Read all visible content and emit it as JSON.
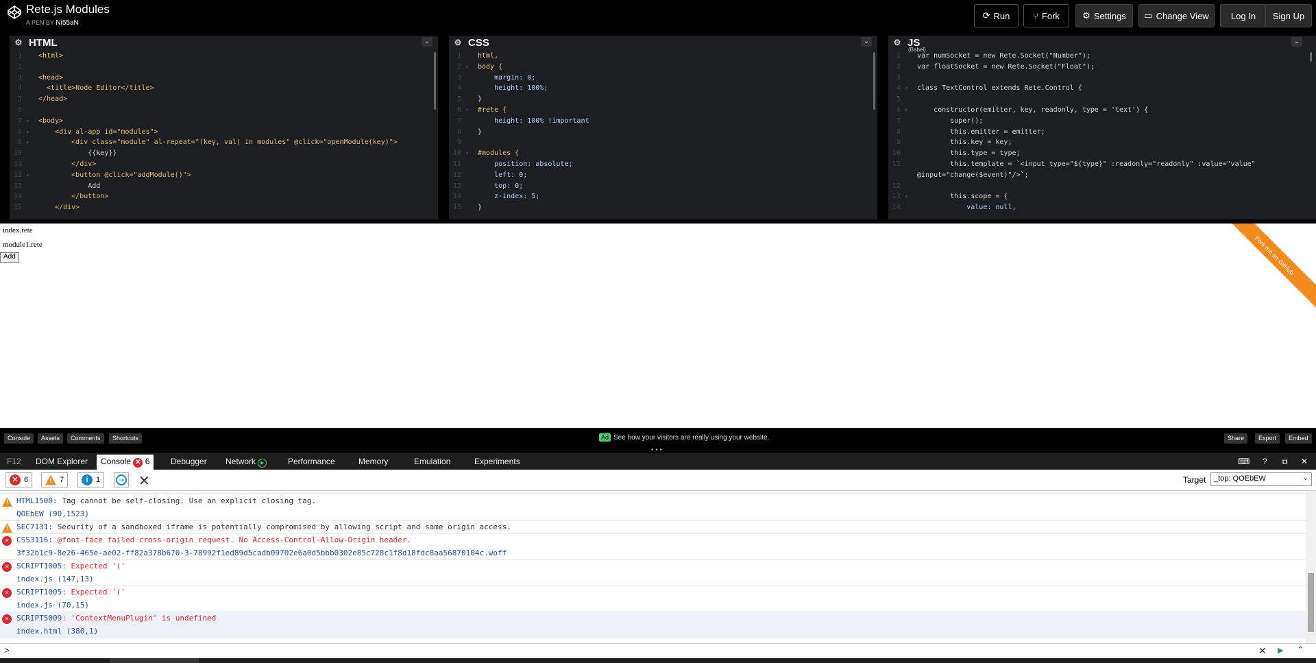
{
  "header": {
    "title": "Rete.js Modules",
    "byline_prefix": "A PEN BY",
    "author": "Ni55aN",
    "buttons": {
      "run": "Run",
      "fork": "Fork",
      "settings": "Settings",
      "change_view": "Change View",
      "log_in": "Log In",
      "sign_up": "Sign Up"
    }
  },
  "editors": {
    "html": {
      "label": "HTML",
      "lines": [
        {
          "n": "1",
          "a": "",
          "t": "<html>"
        },
        {
          "n": "2",
          "a": "",
          "t": ""
        },
        {
          "n": "3",
          "a": "",
          "t": "<head>"
        },
        {
          "n": "4",
          "a": "",
          "t": "  <title>Node Editor</title>"
        },
        {
          "n": "5",
          "a": "",
          "t": "</head>"
        },
        {
          "n": "6",
          "a": "",
          "t": ""
        },
        {
          "n": "7",
          "a": "▾",
          "t": "<body>"
        },
        {
          "n": "8",
          "a": "▾",
          "t": "    <div al-app id=\"modules\">"
        },
        {
          "n": "9",
          "a": "▾",
          "t": "        <div class=\"module\" al-repeat=\"(key, val) in modules\" @click=\"openModule(key)\">"
        },
        {
          "n": "10",
          "a": "",
          "t": "            {{key}}"
        },
        {
          "n": "11",
          "a": "",
          "t": "        </div>"
        },
        {
          "n": "12",
          "a": "▾",
          "t": "        <button @click=\"addModule()\">"
        },
        {
          "n": "13",
          "a": "",
          "t": "            Add"
        },
        {
          "n": "14",
          "a": "",
          "t": "        </button>"
        },
        {
          "n": "15",
          "a": "",
          "t": "    </div>"
        }
      ]
    },
    "css": {
      "label": "CSS",
      "lines": [
        {
          "n": "1",
          "a": "",
          "t": "html,"
        },
        {
          "n": "2",
          "a": "▾",
          "t": "body {"
        },
        {
          "n": "3",
          "a": "",
          "t": "    margin: 0;"
        },
        {
          "n": "4",
          "a": "",
          "t": "    height: 100%;"
        },
        {
          "n": "5",
          "a": "",
          "t": "}"
        },
        {
          "n": "6",
          "a": "▾",
          "t": "#rete {"
        },
        {
          "n": "7",
          "a": "",
          "t": "    height: 100% !important"
        },
        {
          "n": "8",
          "a": "",
          "t": "}"
        },
        {
          "n": "9",
          "a": "",
          "t": ""
        },
        {
          "n": "10",
          "a": "▾",
          "t": "#modules {"
        },
        {
          "n": "11",
          "a": "",
          "t": "    position: absolute;"
        },
        {
          "n": "12",
          "a": "",
          "t": "    left: 0;"
        },
        {
          "n": "13",
          "a": "",
          "t": "    top: 0;"
        },
        {
          "n": "14",
          "a": "",
          "t": "    z-index: 5;"
        },
        {
          "n": "15",
          "a": "",
          "t": "}"
        }
      ]
    },
    "js": {
      "label": "JS",
      "tag": "(Babel)",
      "lines": [
        {
          "n": "1",
          "a": "",
          "t": "var numSocket = new Rete.Socket(\"Number\");"
        },
        {
          "n": "2",
          "a": "",
          "t": "var floatSocket = new Rete.Socket(\"Float\");"
        },
        {
          "n": "3",
          "a": "",
          "t": ""
        },
        {
          "n": "4",
          "a": "▾",
          "t": "class TextControl extends Rete.Control {"
        },
        {
          "n": "5",
          "a": "",
          "t": ""
        },
        {
          "n": "6",
          "a": "▾",
          "t": "    constructor(emitter, key, readonly, type = 'text') {"
        },
        {
          "n": "7",
          "a": "",
          "t": "        super();"
        },
        {
          "n": "8",
          "a": "",
          "t": "        this.emitter = emitter;"
        },
        {
          "n": "9",
          "a": "",
          "t": "        this.key = key;"
        },
        {
          "n": "10",
          "a": "",
          "t": "        this.type = type;"
        },
        {
          "n": "11",
          "a": "",
          "t": "        this.template = `<input type=\"${type}\" :readonly=\"readonly\" :value=\"value\""
        },
        {
          "n": "",
          "a": "",
          "t": "@input=\"change($event)\"/>`;"
        },
        {
          "n": "12",
          "a": "",
          "t": ""
        },
        {
          "n": "13",
          "a": "▾",
          "t": "        this.scope = {"
        },
        {
          "n": "14",
          "a": "",
          "t": "            value: null,"
        }
      ]
    }
  },
  "preview": {
    "items": [
      "index.rete",
      "module1.rete"
    ],
    "add_button": "Add",
    "ribbon": "Fork me on GitHub"
  },
  "footer": {
    "console": "Console",
    "assets": "Assets",
    "comments": "Comments",
    "shortcuts": "Shortcuts",
    "ad_badge": "Ad",
    "ad_text": "See how your visitors are really using your website.",
    "share": "Share",
    "export": "Export",
    "embed": "Embed"
  },
  "devtools": {
    "tabs": {
      "f12": "F12",
      "dom": "DOM Explorer",
      "console": "Console",
      "console_count": "6",
      "debugger": "Debugger",
      "network": "Network",
      "performance": "Performance",
      "memory": "Memory",
      "emulation": "Emulation",
      "experiments": "Experiments"
    },
    "counts": {
      "errors": "6",
      "warnings": "7",
      "info": "1"
    },
    "target_label": "Target",
    "target_value": "_top: QOEbEW",
    "messages": [
      {
        "level": "warning",
        "code": "HTML1500",
        "text": "Tag cannot be self-closing. Use an explicit closing tag.",
        "source": "QOEbEW (90,1523)"
      },
      {
        "level": "warning",
        "code": "SEC7131",
        "text": "Security of a sandboxed iframe is potentially compromised by allowing script and same origin access.",
        "source": ""
      },
      {
        "level": "error",
        "code": "CSS3116",
        "text": "@font-face failed cross-origin request. No Access-Control-Allow-Origin header.",
        "source": "3f32b1c9-8e26-465e-ae02-ff82a378b670-3-78992f1ed89d5cadb09702e6a0d5bbb0302e85c728c1f8d18fdc8aa56870104c.woff"
      },
      {
        "level": "error",
        "code": "SCRIPT1005",
        "text": "Expected '('",
        "source": "index.js (147,13)"
      },
      {
        "level": "error",
        "code": "SCRIPT1005",
        "text": "Expected '('",
        "source": "index.js (70,15)"
      },
      {
        "level": "error",
        "code": "SCRIPT5009",
        "text": "'ContextMenuPlugin' is undefined",
        "source": "index.html (380,1)"
      }
    ],
    "prompt": ">"
  },
  "colors": {
    "accent": "#47cf73",
    "error": "#e0262c",
    "warning": "#f08a1d",
    "info": "#1c7fd0",
    "ribbon": "#f08a1d"
  }
}
